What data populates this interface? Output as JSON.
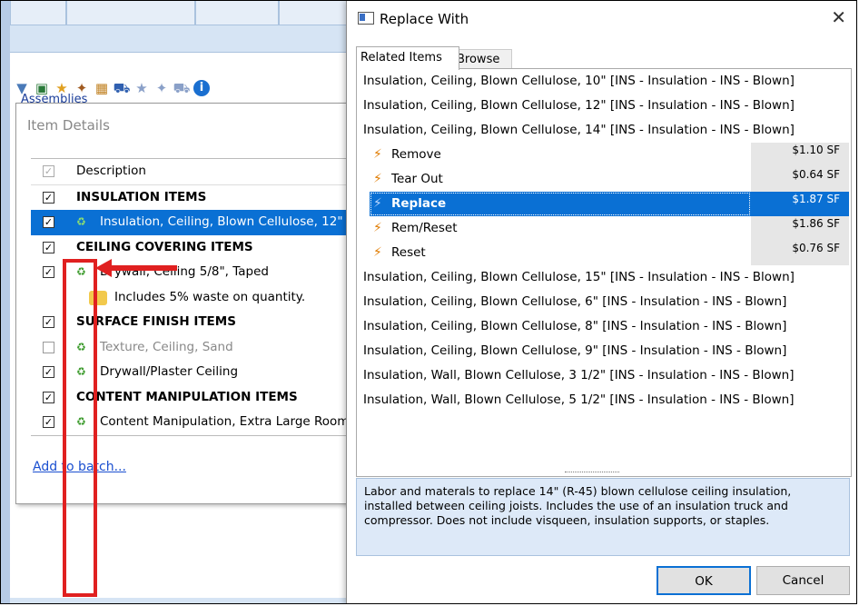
{
  "background": {
    "assemblies_label": "Assemblies",
    "panel_title": "Item Details",
    "toolbar_icons": [
      "filter-icon",
      "image-icon",
      "star-icon",
      "hammer-icon",
      "table-icon",
      "cart-icon",
      "star-outline-icon",
      "hammer-outline-icon",
      "cart-outline-icon",
      "info-icon"
    ],
    "column_header": "Description",
    "rows": [
      {
        "kind": "header",
        "checked": true,
        "text": "INSULATION ITEMS"
      },
      {
        "kind": "item",
        "checked": true,
        "selected": true,
        "text": "Insulation, Ceiling, Blown Cellulose, 12\""
      },
      {
        "kind": "header",
        "checked": true,
        "text": "CEILING COVERING ITEMS"
      },
      {
        "kind": "item",
        "checked": true,
        "text": "Drywall, Ceiling 5/8\", Taped"
      },
      {
        "kind": "note",
        "text": "Includes 5% waste on quantity."
      },
      {
        "kind": "header",
        "checked": true,
        "text": "SURFACE FINISH ITEMS"
      },
      {
        "kind": "item",
        "checked": false,
        "greyed": true,
        "text": "Texture, Ceiling, Sand"
      },
      {
        "kind": "item",
        "checked": true,
        "text": "Drywall/Plaster Ceiling"
      },
      {
        "kind": "header",
        "checked": true,
        "text": "CONTENT MANIPULATION ITEMS"
      },
      {
        "kind": "item",
        "checked": true,
        "text": "Content Manipulation, Extra Large Room"
      }
    ],
    "add_to_batch": "Add to batch...",
    "annotation_color": "#e02020"
  },
  "dialog": {
    "title": "Replace With",
    "close_glyph": "✕",
    "tabs": [
      {
        "label": "Related Items"
      },
      {
        "label": "Browse"
      }
    ],
    "items_top": [
      "Insulation, Ceiling, Blown Cellulose, 10\" [INS - Insulation - INS - Blown]",
      "Insulation, Ceiling, Blown Cellulose, 12\" [INS - Insulation - INS - Blown]",
      "Insulation, Ceiling, Blown Cellulose, 14\" [INS - Insulation - INS - Blown]"
    ],
    "sub_items": [
      {
        "label": "Remove",
        "price": "$1.10 SF"
      },
      {
        "label": "Tear Out",
        "price": "$0.64 SF"
      },
      {
        "label": "Replace",
        "price": "$1.87 SF",
        "selected": true
      },
      {
        "label": "Rem/Reset",
        "price": "$1.86 SF"
      },
      {
        "label": "Reset",
        "price": "$0.76 SF"
      }
    ],
    "items_bottom": [
      "Insulation, Ceiling, Blown Cellulose, 15\" [INS - Insulation - INS - Blown]",
      "Insulation, Ceiling, Blown Cellulose, 6\" [INS - Insulation - INS - Blown]",
      "Insulation, Ceiling, Blown Cellulose, 8\" [INS - Insulation - INS - Blown]",
      "Insulation, Ceiling, Blown Cellulose, 9\" [INS - Insulation - INS - Blown]",
      "Insulation, Wall, Blown Cellulose, 3 1/2\" [INS - Insulation - INS - Blown]",
      "Insulation, Wall, Blown Cellulose, 5 1/2\" [INS - Insulation - INS - Blown]"
    ],
    "description": "Labor and materals to replace 14\" (R-45) blown cellulose ceiling insulation, installed between ceiling joists.  Includes the use of an insulation truck and compressor.  Does not include visqueen, insulation supports, or staples.",
    "ok_label": "OK",
    "cancel_label": "Cancel",
    "accent_color": "#0a70d4"
  }
}
